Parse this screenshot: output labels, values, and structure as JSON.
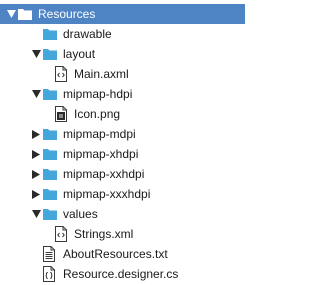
{
  "colors": {
    "selection": "#4f84c4",
    "folder": "#45a6dc",
    "file_stroke": "#3a3a3a"
  },
  "tree": {
    "root": {
      "label": "Resources",
      "expanded": true,
      "selected": true,
      "icon": "folder-icon"
    },
    "drawable": {
      "label": "drawable",
      "icon": "folder-icon"
    },
    "layout": {
      "label": "layout",
      "expanded": true,
      "icon": "folder-icon"
    },
    "main_axml": {
      "label": "Main.axml",
      "icon": "xml-file-icon"
    },
    "mipmap_hdpi": {
      "label": "mipmap-hdpi",
      "expanded": true,
      "icon": "folder-icon"
    },
    "icon_png": {
      "label": "Icon.png",
      "icon": "image-file-icon"
    },
    "mipmap_mdpi": {
      "label": "mipmap-mdpi",
      "expanded": false,
      "icon": "folder-icon"
    },
    "mipmap_xhdpi": {
      "label": "mipmap-xhdpi",
      "expanded": false,
      "icon": "folder-icon"
    },
    "mipmap_xxhdpi": {
      "label": "mipmap-xxhdpi",
      "expanded": false,
      "icon": "folder-icon"
    },
    "mipmap_xxxhdpi": {
      "label": "mipmap-xxxhdpi",
      "expanded": false,
      "icon": "folder-icon"
    },
    "values": {
      "label": "values",
      "expanded": true,
      "icon": "folder-icon"
    },
    "strings_xml": {
      "label": "Strings.xml",
      "icon": "xml-file-icon"
    },
    "about_resources": {
      "label": "AboutResources.txt",
      "icon": "text-file-icon"
    },
    "resource_designer": {
      "label": "Resource.designer.cs",
      "icon": "code-file-icon"
    }
  }
}
